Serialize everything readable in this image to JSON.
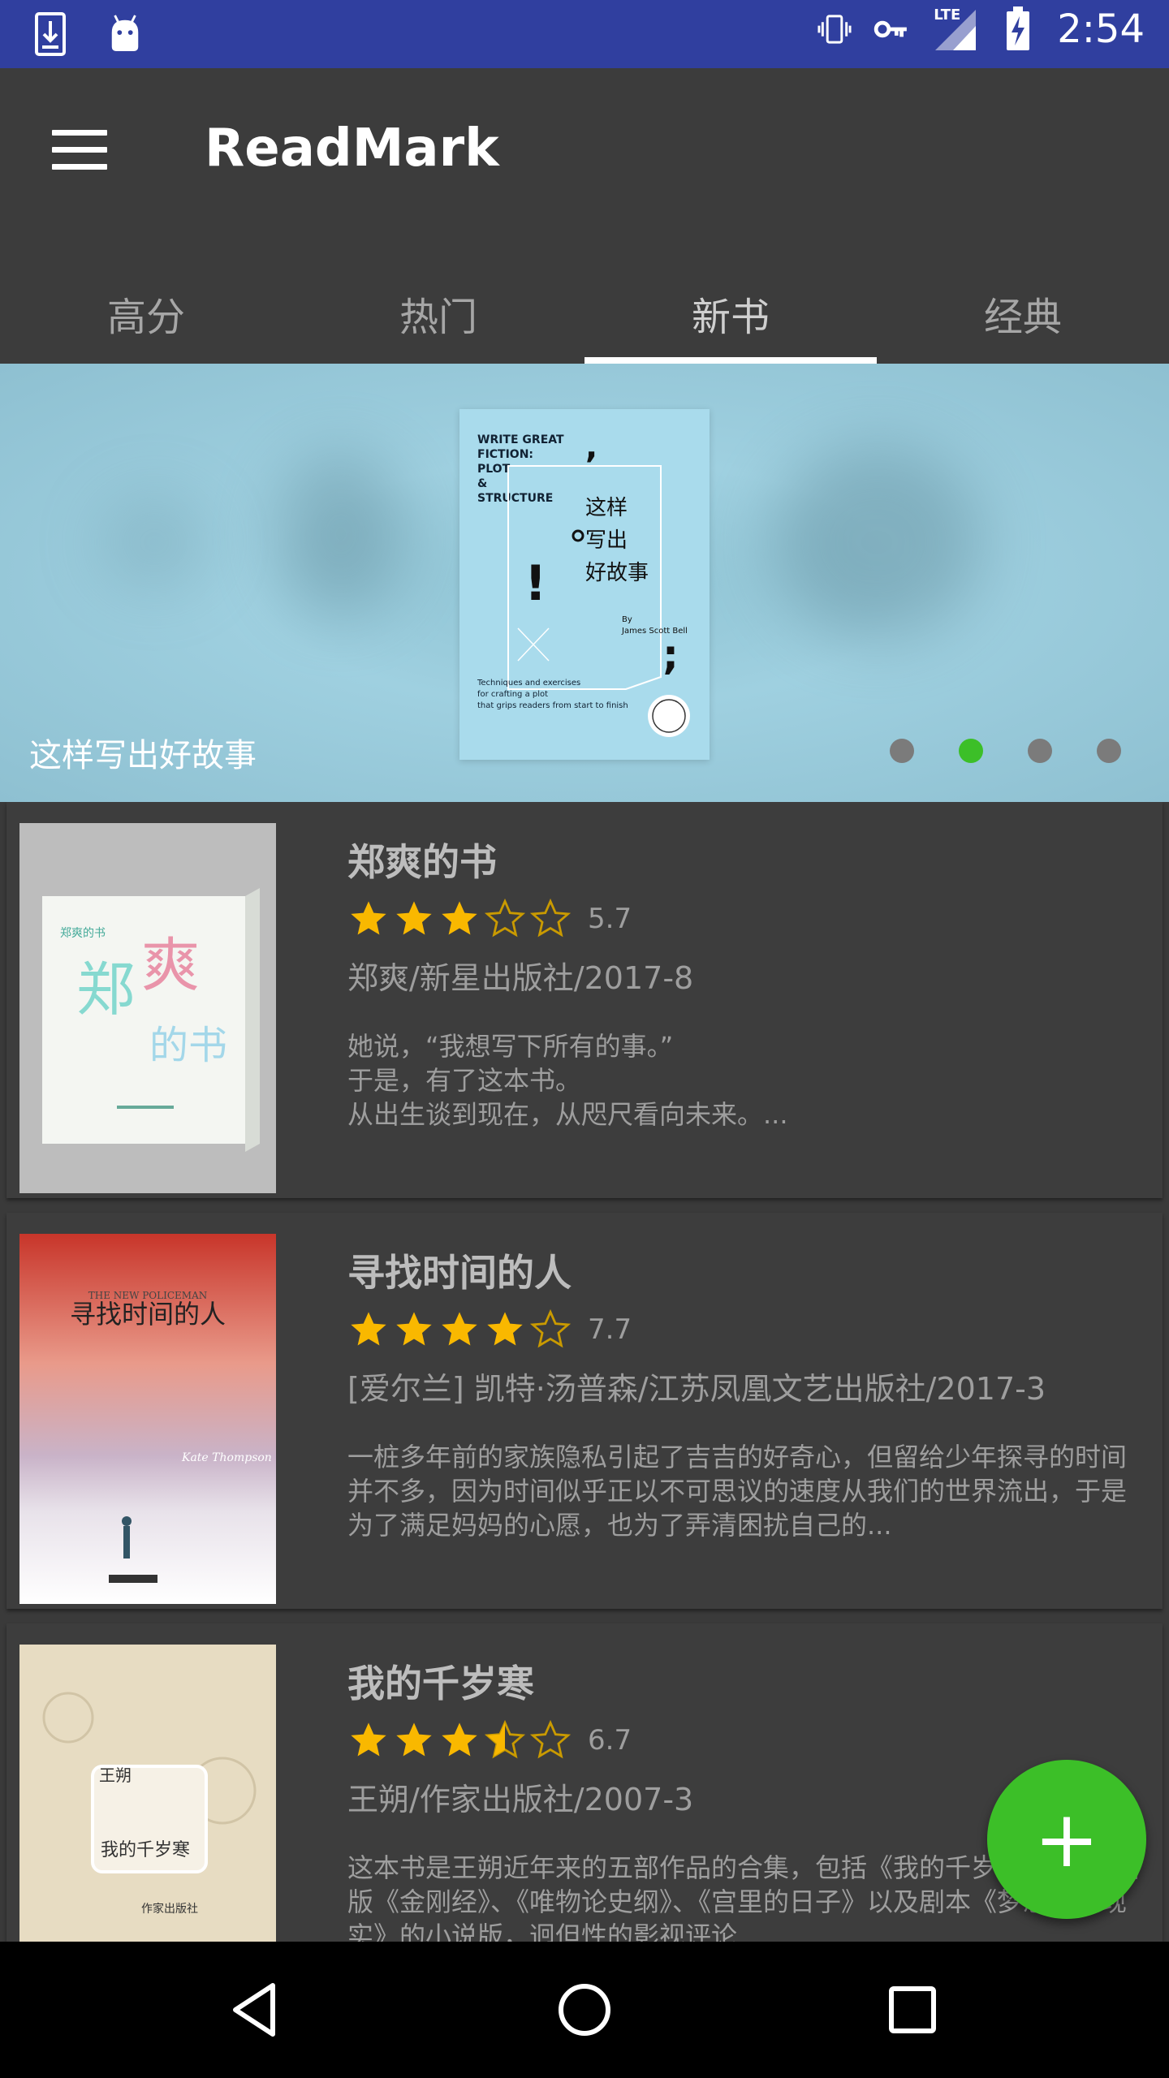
{
  "status_bar": {
    "time": "2:54",
    "network": "LTE",
    "icons": [
      "download-icon",
      "android-icon",
      "vibrate-icon",
      "vpn-key-icon",
      "signal-icon",
      "battery-charging-icon"
    ]
  },
  "app_bar": {
    "title": "ReadMark",
    "menu_icon": "hamburger-menu-icon"
  },
  "tabs": [
    {
      "label": "高分",
      "active": false
    },
    {
      "label": "热门",
      "active": false
    },
    {
      "label": "新书",
      "active": true
    },
    {
      "label": "经典",
      "active": false
    }
  ],
  "banner": {
    "caption": "这样写出好故事",
    "dots": 4,
    "active_dot": 2,
    "book_cover_text": {
      "en_title": "WRITE GREAT FICTION: PLOT & STRUCTURE",
      "cn_title": "这样写出好故事",
      "author": "By James Scott Bell",
      "tagline": "Techniques and exercises for crafting a plot that grips readers from start to finish"
    }
  },
  "books": [
    {
      "title": "郑爽的书",
      "rating": "5.7",
      "stars": 3,
      "meta": "郑爽/新星出版社/2017-8",
      "summary": "    她说，“我想写下所有的事。”\n于是，有了这本书。\n从出生谈到现在，从咫尺看向未来。..."
    },
    {
      "title": "寻找时间的人",
      "rating": "7.7",
      "stars": 4,
      "meta": "[爱尔兰] 凯特·汤普森/江苏凤凰文艺出版社/2017-3",
      "summary": "    一桩多年前的家族隐私引起了吉吉的好奇心，但留给少年探寻的时间并不多，因为时间似乎正以不可思议的速度从我们的世界流出，于是为了满足妈妈的心愿，也为了弄清困扰自己的..."
    },
    {
      "title": "我的千岁寒",
      "rating": "6.7",
      "stars": 3.5,
      "meta": "王朔/作家出版社/2007-3",
      "summary": "    这本书是王朔近年来的五部作品的合集，包括《我的千岁寒》、北京话版《金刚经》、《唯物论史纲》、《宫里的日子》以及剧本《梦想照进现实》的小说版，迥但性的影视评论..."
    }
  ],
  "fab": {
    "label": "+"
  },
  "colors": {
    "status_bar": "#303f9f",
    "app_bar": "#3c3c3c",
    "accent": "#3cbf28",
    "star": "#f9b800"
  }
}
